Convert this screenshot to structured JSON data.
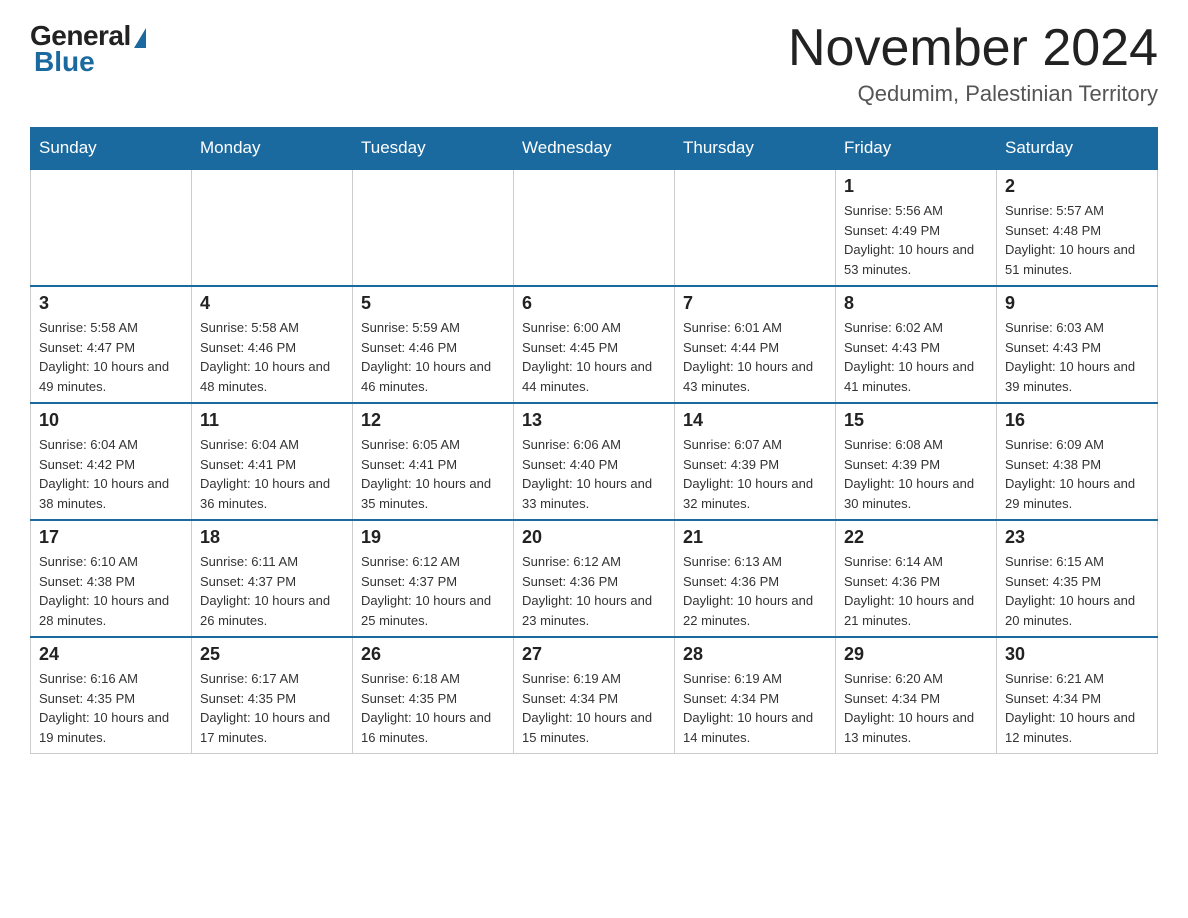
{
  "logo": {
    "text_general": "General",
    "text_blue": "Blue"
  },
  "header": {
    "month_title": "November 2024",
    "location": "Qedumim, Palestinian Territory"
  },
  "weekdays": [
    "Sunday",
    "Monday",
    "Tuesday",
    "Wednesday",
    "Thursday",
    "Friday",
    "Saturday"
  ],
  "weeks": [
    [
      {
        "day": "",
        "sunrise": "",
        "sunset": "",
        "daylight": ""
      },
      {
        "day": "",
        "sunrise": "",
        "sunset": "",
        "daylight": ""
      },
      {
        "day": "",
        "sunrise": "",
        "sunset": "",
        "daylight": ""
      },
      {
        "day": "",
        "sunrise": "",
        "sunset": "",
        "daylight": ""
      },
      {
        "day": "",
        "sunrise": "",
        "sunset": "",
        "daylight": ""
      },
      {
        "day": "1",
        "sunrise": "Sunrise: 5:56 AM",
        "sunset": "Sunset: 4:49 PM",
        "daylight": "Daylight: 10 hours and 53 minutes."
      },
      {
        "day": "2",
        "sunrise": "Sunrise: 5:57 AM",
        "sunset": "Sunset: 4:48 PM",
        "daylight": "Daylight: 10 hours and 51 minutes."
      }
    ],
    [
      {
        "day": "3",
        "sunrise": "Sunrise: 5:58 AM",
        "sunset": "Sunset: 4:47 PM",
        "daylight": "Daylight: 10 hours and 49 minutes."
      },
      {
        "day": "4",
        "sunrise": "Sunrise: 5:58 AM",
        "sunset": "Sunset: 4:46 PM",
        "daylight": "Daylight: 10 hours and 48 minutes."
      },
      {
        "day": "5",
        "sunrise": "Sunrise: 5:59 AM",
        "sunset": "Sunset: 4:46 PM",
        "daylight": "Daylight: 10 hours and 46 minutes."
      },
      {
        "day": "6",
        "sunrise": "Sunrise: 6:00 AM",
        "sunset": "Sunset: 4:45 PM",
        "daylight": "Daylight: 10 hours and 44 minutes."
      },
      {
        "day": "7",
        "sunrise": "Sunrise: 6:01 AM",
        "sunset": "Sunset: 4:44 PM",
        "daylight": "Daylight: 10 hours and 43 minutes."
      },
      {
        "day": "8",
        "sunrise": "Sunrise: 6:02 AM",
        "sunset": "Sunset: 4:43 PM",
        "daylight": "Daylight: 10 hours and 41 minutes."
      },
      {
        "day": "9",
        "sunrise": "Sunrise: 6:03 AM",
        "sunset": "Sunset: 4:43 PM",
        "daylight": "Daylight: 10 hours and 39 minutes."
      }
    ],
    [
      {
        "day": "10",
        "sunrise": "Sunrise: 6:04 AM",
        "sunset": "Sunset: 4:42 PM",
        "daylight": "Daylight: 10 hours and 38 minutes."
      },
      {
        "day": "11",
        "sunrise": "Sunrise: 6:04 AM",
        "sunset": "Sunset: 4:41 PM",
        "daylight": "Daylight: 10 hours and 36 minutes."
      },
      {
        "day": "12",
        "sunrise": "Sunrise: 6:05 AM",
        "sunset": "Sunset: 4:41 PM",
        "daylight": "Daylight: 10 hours and 35 minutes."
      },
      {
        "day": "13",
        "sunrise": "Sunrise: 6:06 AM",
        "sunset": "Sunset: 4:40 PM",
        "daylight": "Daylight: 10 hours and 33 minutes."
      },
      {
        "day": "14",
        "sunrise": "Sunrise: 6:07 AM",
        "sunset": "Sunset: 4:39 PM",
        "daylight": "Daylight: 10 hours and 32 minutes."
      },
      {
        "day": "15",
        "sunrise": "Sunrise: 6:08 AM",
        "sunset": "Sunset: 4:39 PM",
        "daylight": "Daylight: 10 hours and 30 minutes."
      },
      {
        "day": "16",
        "sunrise": "Sunrise: 6:09 AM",
        "sunset": "Sunset: 4:38 PM",
        "daylight": "Daylight: 10 hours and 29 minutes."
      }
    ],
    [
      {
        "day": "17",
        "sunrise": "Sunrise: 6:10 AM",
        "sunset": "Sunset: 4:38 PM",
        "daylight": "Daylight: 10 hours and 28 minutes."
      },
      {
        "day": "18",
        "sunrise": "Sunrise: 6:11 AM",
        "sunset": "Sunset: 4:37 PM",
        "daylight": "Daylight: 10 hours and 26 minutes."
      },
      {
        "day": "19",
        "sunrise": "Sunrise: 6:12 AM",
        "sunset": "Sunset: 4:37 PM",
        "daylight": "Daylight: 10 hours and 25 minutes."
      },
      {
        "day": "20",
        "sunrise": "Sunrise: 6:12 AM",
        "sunset": "Sunset: 4:36 PM",
        "daylight": "Daylight: 10 hours and 23 minutes."
      },
      {
        "day": "21",
        "sunrise": "Sunrise: 6:13 AM",
        "sunset": "Sunset: 4:36 PM",
        "daylight": "Daylight: 10 hours and 22 minutes."
      },
      {
        "day": "22",
        "sunrise": "Sunrise: 6:14 AM",
        "sunset": "Sunset: 4:36 PM",
        "daylight": "Daylight: 10 hours and 21 minutes."
      },
      {
        "day": "23",
        "sunrise": "Sunrise: 6:15 AM",
        "sunset": "Sunset: 4:35 PM",
        "daylight": "Daylight: 10 hours and 20 minutes."
      }
    ],
    [
      {
        "day": "24",
        "sunrise": "Sunrise: 6:16 AM",
        "sunset": "Sunset: 4:35 PM",
        "daylight": "Daylight: 10 hours and 19 minutes."
      },
      {
        "day": "25",
        "sunrise": "Sunrise: 6:17 AM",
        "sunset": "Sunset: 4:35 PM",
        "daylight": "Daylight: 10 hours and 17 minutes."
      },
      {
        "day": "26",
        "sunrise": "Sunrise: 6:18 AM",
        "sunset": "Sunset: 4:35 PM",
        "daylight": "Daylight: 10 hours and 16 minutes."
      },
      {
        "day": "27",
        "sunrise": "Sunrise: 6:19 AM",
        "sunset": "Sunset: 4:34 PM",
        "daylight": "Daylight: 10 hours and 15 minutes."
      },
      {
        "day": "28",
        "sunrise": "Sunrise: 6:19 AM",
        "sunset": "Sunset: 4:34 PM",
        "daylight": "Daylight: 10 hours and 14 minutes."
      },
      {
        "day": "29",
        "sunrise": "Sunrise: 6:20 AM",
        "sunset": "Sunset: 4:34 PM",
        "daylight": "Daylight: 10 hours and 13 minutes."
      },
      {
        "day": "30",
        "sunrise": "Sunrise: 6:21 AM",
        "sunset": "Sunset: 4:34 PM",
        "daylight": "Daylight: 10 hours and 12 minutes."
      }
    ]
  ]
}
